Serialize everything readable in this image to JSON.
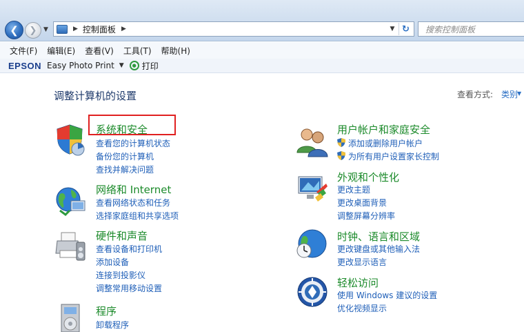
{
  "address": {
    "path": "控制面板",
    "search_placeholder": "搜索控制面板"
  },
  "menu": [
    "文件(F)",
    "编辑(E)",
    "查看(V)",
    "工具(T)",
    "帮助(H)"
  ],
  "epson": {
    "brand": "EPSON",
    "app": "Easy Photo Print",
    "print": "打印"
  },
  "page": {
    "title": "调整计算机的设置",
    "view_by_label": "查看方式:",
    "view_by_value": "类别"
  },
  "left_categories": [
    {
      "title": "系统和安全",
      "links": [
        "查看您的计算机状态",
        "备份您的计算机",
        "查找并解决问题"
      ]
    },
    {
      "title": "网络和 Internet",
      "links": [
        "查看网络状态和任务",
        "选择家庭组和共享选项"
      ]
    },
    {
      "title": "硬件和声音",
      "links": [
        "查看设备和打印机",
        "添加设备",
        "连接到投影仪",
        "调整常用移动设置"
      ]
    },
    {
      "title": "程序",
      "links": [
        "卸载程序"
      ]
    }
  ],
  "right_categories": [
    {
      "title": "用户帐户和家庭安全",
      "links": [
        "添加或删除用户帐户",
        "为所有用户设置家长控制"
      ]
    },
    {
      "title": "外观和个性化",
      "links": [
        "更改主题",
        "更改桌面背景",
        "调整屏幕分辨率"
      ]
    },
    {
      "title": "时钟、语言和区域",
      "links": [
        "更改键盘或其他输入法",
        "更改显示语言"
      ]
    },
    {
      "title": "轻松访问",
      "links": [
        "使用 Windows 建议的设置",
        "优化视频显示"
      ]
    }
  ],
  "colors": {
    "category_title": "#1b8a2a",
    "link": "#1f5fb8",
    "highlight": "#e02020"
  }
}
